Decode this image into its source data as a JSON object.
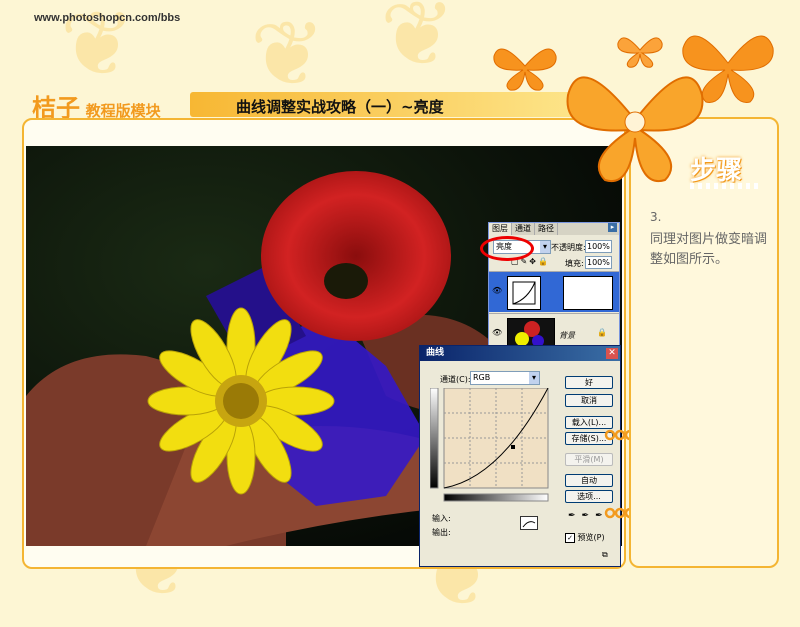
{
  "site": {
    "url": "www.photoshopcn.com/bbs"
  },
  "module": {
    "logo_main": "桔子",
    "logo_sub": "教程版模块"
  },
  "tutorial": {
    "title": "曲线调整实战攻略（一）~亮度"
  },
  "step": {
    "heading": "步骤",
    "number": "3.",
    "description": "同理对图片做变暗调整如图所示。"
  },
  "layers_panel": {
    "tabs": [
      "图层",
      "通道",
      "路径"
    ],
    "blend_mode": "亮度",
    "opacity_label": "不透明度:",
    "opacity_value": "100%",
    "fill_label": "填充:",
    "fill_value": "100%",
    "background_layer_name": "背景"
  },
  "curves_dialog": {
    "title": "曲线",
    "channel_label": "通道(C):",
    "channel_value": "RGB",
    "buttons": {
      "ok": "好",
      "cancel": "取消",
      "load": "载入(L)...",
      "save": "存储(S)...",
      "smooth": "平滑(M)",
      "auto": "自动",
      "options": "选项..."
    },
    "input_label": "输入:",
    "output_label": "输出:",
    "preview_label": "预览(P)",
    "preview_checked": true
  },
  "colors": {
    "accent": "#f4b533",
    "title_gradient_start": "#f7b733",
    "logo": "#f29a1e"
  }
}
